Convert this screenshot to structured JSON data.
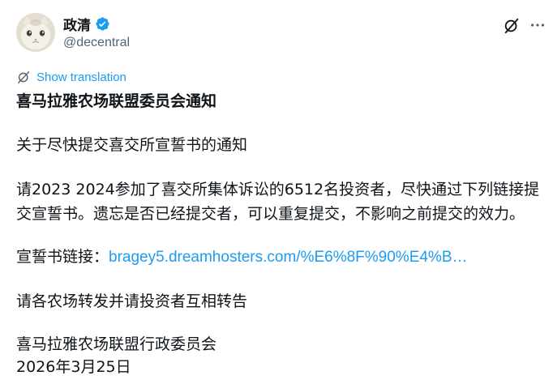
{
  "author": {
    "name": "政清",
    "handle": "@decentral"
  },
  "translation": {
    "label": "Show translation"
  },
  "post": {
    "headline": "喜马拉雅农场联盟委员会通知",
    "line1": "关于尽快提交喜交所宣誓书的通知",
    "paragraph2": "请2023 2024参加了喜交所集体诉讼的6512名投资者，尽快通过下列链接提交宣誓书。遗忘是否已经提交者，可以重复提交，不影响之前提交的效力。",
    "link_label": "宣誓书链接：",
    "link_text": "bragey5.dreamhosters.com/%E6%8F%90%E4%B…",
    "line4": "请各农场转发并请投资者互相转告",
    "signature": "喜马拉雅农场联盟行政委员会",
    "date": "2026年3月25日"
  },
  "colors": {
    "text": "#0f1419",
    "secondary": "#536471",
    "accent": "#1d9bf0"
  },
  "icons": {
    "verified": "verified-badge-icon",
    "grok": "grok-icon",
    "more": "more-dots-icon",
    "translate": "translate-icon"
  }
}
